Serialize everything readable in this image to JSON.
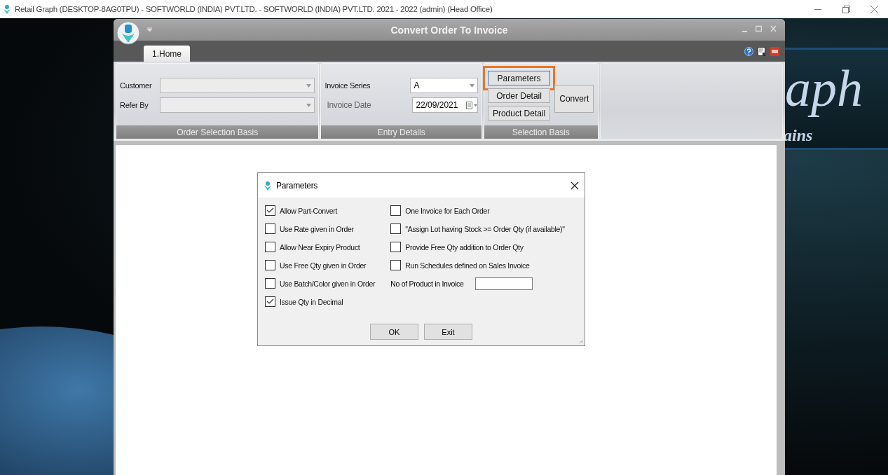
{
  "window": {
    "title": "Retail Graph (DESKTOP-8AG0TPU) - SOFTWORLD (INDIA) PVT.LTD. - SOFTWORLD (INDIA) PVT.LTD.  2021 - 2022 (admin) (Head Office)"
  },
  "backdrop": {
    "texts": [
      "aph",
      "ains"
    ]
  },
  "app": {
    "title": "Convert Order To Invoice",
    "tabs": [
      {
        "label": "1.Home",
        "selected": true
      }
    ],
    "ribbon": {
      "groups": [
        {
          "caption": "Order Selection Basis",
          "fields": [
            {
              "kind": "combo",
              "label": "Customer",
              "disabled": false
            },
            {
              "kind": "combo",
              "label": "Refer By",
              "disabled": false
            }
          ]
        },
        {
          "caption": "Entry Details",
          "fields": [
            {
              "kind": "combo",
              "label": "Invoice Series",
              "value": "A",
              "disabled": false
            },
            {
              "kind": "date",
              "label": "Invoice Date",
              "value": "22/09/2021",
              "disabled": true
            }
          ]
        },
        {
          "caption": "Selection Basis",
          "buttons": [
            {
              "kind": "stacked",
              "label": "Parameters",
              "highlighted": true
            },
            {
              "kind": "stacked",
              "label": "Order Detail",
              "highlighted": false
            },
            {
              "kind": "stacked",
              "label": "Product Detail",
              "highlighted": false
            },
            {
              "kind": "side",
              "label": "Convert",
              "highlighted": false
            }
          ]
        }
      ]
    }
  },
  "dialog": {
    "title": "Parameters",
    "left_options": [
      {
        "label": "Allow Part-Convert",
        "checked": true
      },
      {
        "label": "Use Rate given in Order",
        "checked": false
      },
      {
        "label": "Allow Near Expiry Product",
        "checked": false
      },
      {
        "label": "Use Free Qty given in Order",
        "checked": false
      },
      {
        "label": "Use Batch/Color given in Order",
        "checked": false
      },
      {
        "label": "Issue Qty in Decimal",
        "checked": true
      }
    ],
    "right_options": [
      {
        "label": "One Invoice for Each Order",
        "checked": false
      },
      {
        "label": "\"Assign Lot having Stock >= Order Qty (if available)\"",
        "checked": false
      },
      {
        "label": "Provide Free Qty addition to Order Qty",
        "checked": false
      },
      {
        "label": "Run Schedules defined on Sales Invoice",
        "checked": false
      }
    ],
    "number_field": {
      "label": "No of Product in Invoice"
    },
    "buttons": [
      "OK",
      "Exit"
    ]
  }
}
